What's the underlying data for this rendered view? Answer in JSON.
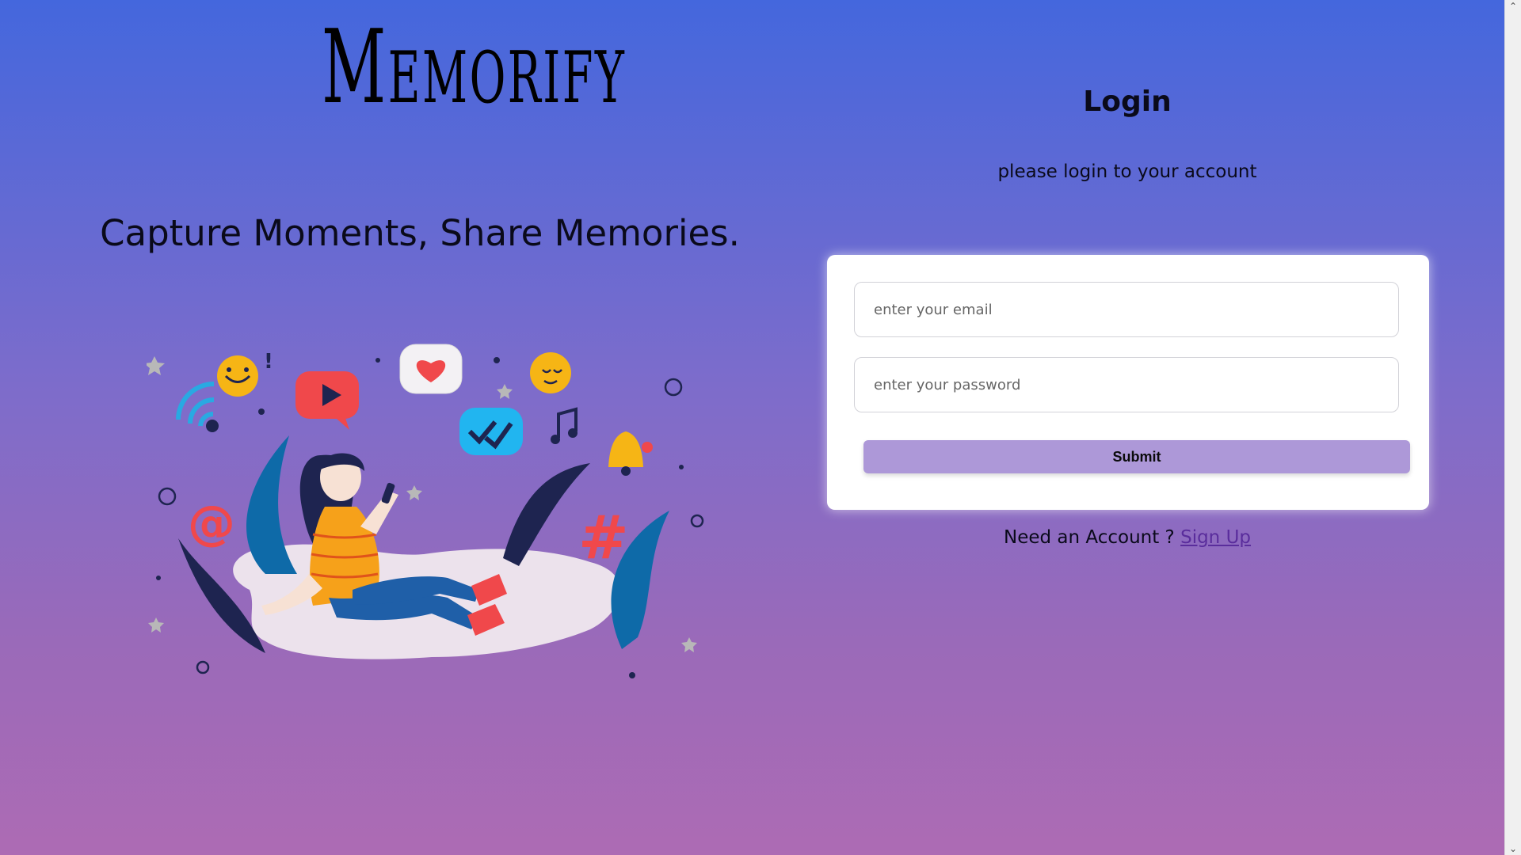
{
  "brand": {
    "logo_text": "Memorify",
    "tagline": "Capture Moments, Share Memories."
  },
  "login": {
    "title": "Login",
    "subtitle": "please login to your account",
    "email_placeholder": "enter your email",
    "password_placeholder": "enter your password",
    "submit_label": "Submit",
    "need_account_text": "Need an Account ?",
    "signup_label": "Sign Up"
  },
  "colors": {
    "gradient_top": "#4467dd",
    "gradient_bottom": "#ad6bb4",
    "submit_bg": "#ad98d8",
    "signup_link": "#5a2d9c"
  },
  "illustration": {
    "icons": [
      "emoji-smile-icon",
      "play-bubble-icon",
      "heart-bubble-icon",
      "emoji-blush-icon",
      "wifi-icon",
      "check-bubble-icon",
      "music-note-icon",
      "bell-icon",
      "at-sign-icon",
      "hashtag-icon",
      "star-icon"
    ]
  }
}
